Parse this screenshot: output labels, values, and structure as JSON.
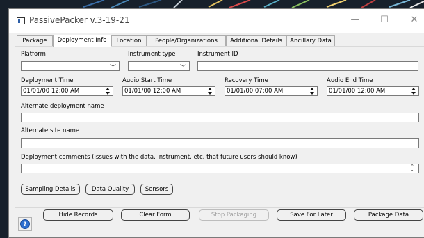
{
  "window": {
    "title": "PassivePacker v.3-19-21",
    "minimize_glyph": "—",
    "maximize_glyph": "☐",
    "close_glyph": "✕"
  },
  "tabs": [
    {
      "label": "Package",
      "active": false
    },
    {
      "label": "Deployment Info",
      "active": true
    },
    {
      "label": "Location",
      "active": false
    },
    {
      "label": "People/Organizations",
      "active": false
    },
    {
      "label": "Additional Details",
      "active": false
    },
    {
      "label": "Ancillary Data",
      "active": false
    }
  ],
  "form": {
    "platform_label": "Platform",
    "platform_value": "",
    "instrument_type_label": "Instrument type",
    "instrument_type_value": "",
    "instrument_id_label": "Instrument ID",
    "instrument_id_value": "",
    "deployment_time_label": "Deployment Time",
    "deployment_time_value": "01/01/00 12:00 AM",
    "audio_start_label": "Audio Start Time",
    "audio_start_value": "01/01/00 12:00 AM",
    "recovery_time_label": "Recovery Time",
    "recovery_time_value": "01/01/00 07:00 AM",
    "audio_end_label": "Audio End Time",
    "audio_end_value": "01/01/00 12:00 AM",
    "alt_deployment_label": "Alternate deployment name",
    "alt_deployment_value": "",
    "alt_site_label": "Alternate site name",
    "alt_site_value": "",
    "comments_label": "Deployment comments (issues with the data, instrument, etc. that future users should know)",
    "comments_value": ""
  },
  "panel_buttons": {
    "sampling": "Sampling Details",
    "quality": "Data Quality",
    "sensors": "Sensors"
  },
  "footer": {
    "help_glyph": "?",
    "hide_records": "Hide Records",
    "clear_form": "Clear Form",
    "stop_packaging": "Stop Packaging",
    "save_later": "Save For Later",
    "package_data": "Package Data"
  },
  "colors": {
    "window_bg": "#f0f0f0",
    "accent_help": "#2e6fcf",
    "desktop_bg": "#17202b"
  }
}
